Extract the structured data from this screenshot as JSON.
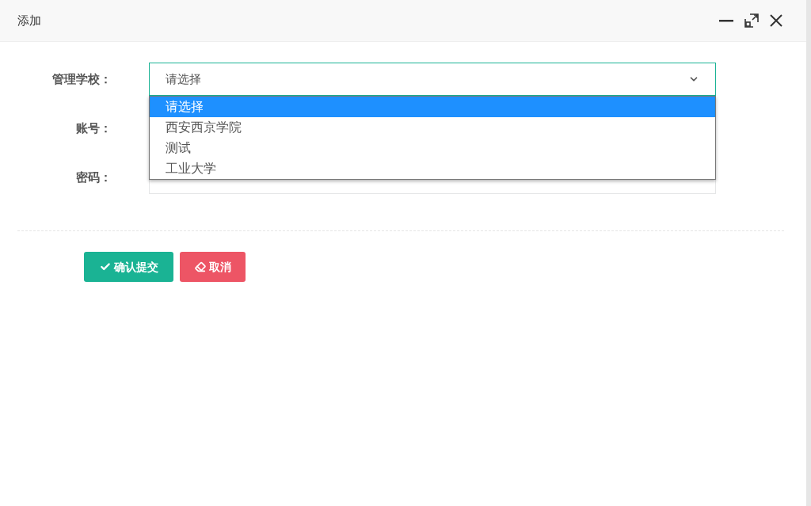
{
  "dialog": {
    "title": "添加"
  },
  "fields": [
    {
      "kind": "select",
      "label": "管理学校：",
      "value": "请选择",
      "expanded": true,
      "options": [
        {
          "label": "请选择",
          "selected": true
        },
        {
          "label": "西安西京学院",
          "selected": false
        },
        {
          "label": "测试",
          "selected": false
        },
        {
          "label": "工业大学",
          "selected": false
        }
      ]
    },
    {
      "kind": "text",
      "label": "账号："
    },
    {
      "kind": "password",
      "label": "密码："
    }
  ],
  "buttons": [
    {
      "kind": "submit",
      "label": "确认提交"
    },
    {
      "kind": "cancel",
      "label": "取消"
    }
  ]
}
